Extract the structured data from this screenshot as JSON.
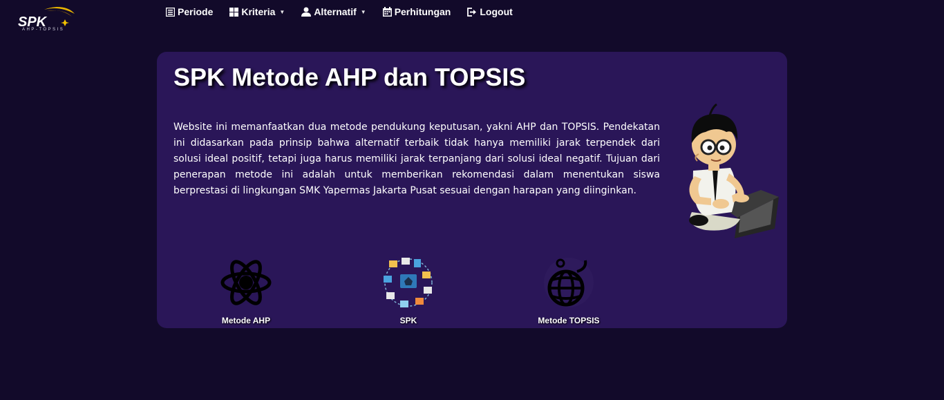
{
  "brand": {
    "logo_text": "SPK",
    "logo_tagline": "AHP-TOPSIS"
  },
  "nav": {
    "items": [
      {
        "label": "Periode",
        "icon": "list-icon",
        "dropdown": false
      },
      {
        "label": "Kriteria",
        "icon": "grid-icon",
        "dropdown": true
      },
      {
        "label": "Alternatif",
        "icon": "user-icon",
        "dropdown": true
      },
      {
        "label": "Perhitungan",
        "icon": "calendar-icon",
        "dropdown": false
      },
      {
        "label": "Logout",
        "icon": "logout-icon",
        "dropdown": false
      }
    ]
  },
  "hero": {
    "title": "SPK Metode AHP dan TOPSIS",
    "description": "Website ini memanfaatkan dua metode pendukung keputusan, yakni AHP dan TOPSIS. Pendekatan ini didasarkan pada prinsip bahwa alternatif terbaik tidak hanya memiliki jarak terpendek dari solusi ideal positif, tetapi juga harus memiliki jarak terpanjang dari solusi ideal negatif. Tujuan dari penerapan metode ini adalah untuk memberikan rekomendasi dalam menentukan siswa berprestasi di lingkungan SMK Yapermas Jakarta Pusat sesuai dengan harapan yang diinginkan."
  },
  "features": [
    {
      "label": "Metode AHP",
      "icon": "atom-icon"
    },
    {
      "label": "SPK",
      "icon": "network-icon"
    },
    {
      "label": "Metode TOPSIS",
      "icon": "globe-icon"
    }
  ],
  "colors": {
    "background": "#120a2a",
    "panel": "#2a1658",
    "text": "#ffffff"
  }
}
